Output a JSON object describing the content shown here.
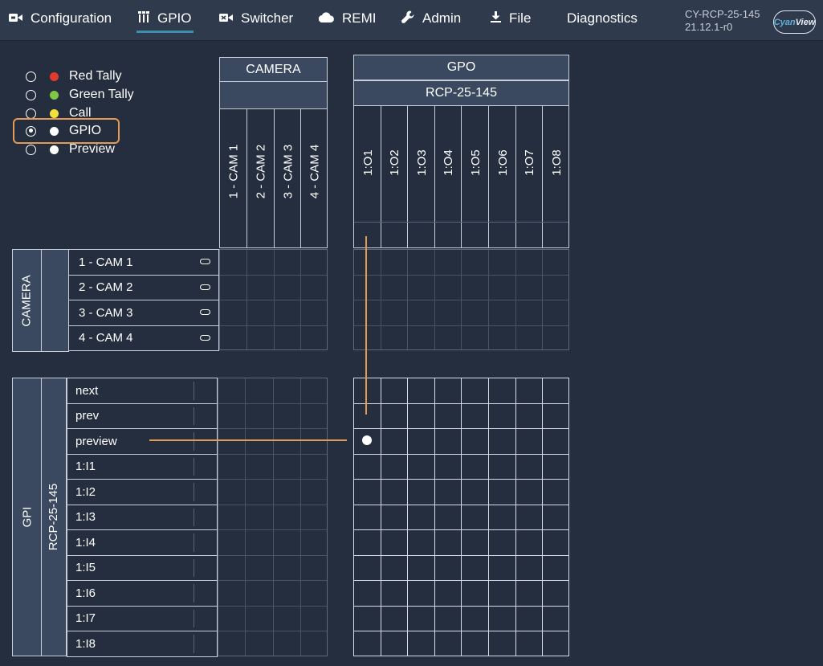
{
  "nav": {
    "configuration": "Configuration",
    "gpio": "GPIO",
    "switcher": "Switcher",
    "remi": "REMI",
    "admin": "Admin",
    "file": "File",
    "diagnostics": "Diagnostics",
    "active": "GPIO"
  },
  "device": {
    "name": "CY-RCP-25-145",
    "version": "21.12.1-r0"
  },
  "logo": {
    "part1": "Cyan",
    "part2": "View"
  },
  "legend": [
    {
      "label": "Red Tally",
      "color": "#e23a2e",
      "selected": false
    },
    {
      "label": "Green Tally",
      "color": "#7ec843",
      "selected": false
    },
    {
      "label": "Call",
      "color": "#f3e23a",
      "selected": false
    },
    {
      "label": "GPIO",
      "color": "#ffffff",
      "selected": true
    },
    {
      "label": "Preview",
      "color": "#ffffff",
      "selected": false
    }
  ],
  "camera_header": "CAMERA",
  "camera_columns": [
    "1 - CAM 1",
    "2 - CAM 2",
    "3 - CAM 3",
    "4 - CAM 4"
  ],
  "gpo_header": "GPO",
  "gpo_device": "RCP-25-145",
  "gpo_columns": [
    "1:O1",
    "1:O2",
    "1:O3",
    "1:O4",
    "1:O5",
    "1:O6",
    "1:O7",
    "1:O8"
  ],
  "camera_side_label": "CAMERA",
  "camera_rows": [
    "1 - CAM 1",
    "2 - CAM 2",
    "3 - CAM 3",
    "4 - CAM 4"
  ],
  "gpi_side_label": "GPI",
  "gpi_device": "RCP-25-145",
  "gpi_rows": [
    "next",
    "prev",
    "preview",
    "1:I1",
    "1:I2",
    "1:I3",
    "1:I4",
    "1:I5",
    "1:I6",
    "1:I7",
    "1:I8"
  ],
  "active_crosspoint": {
    "gpi": "preview",
    "gpo": "1:O1"
  },
  "colors": {
    "accent": "#e59a54",
    "background": "#252e3e",
    "header": "#3a4960",
    "tab_underline": "#3d8fb0"
  }
}
